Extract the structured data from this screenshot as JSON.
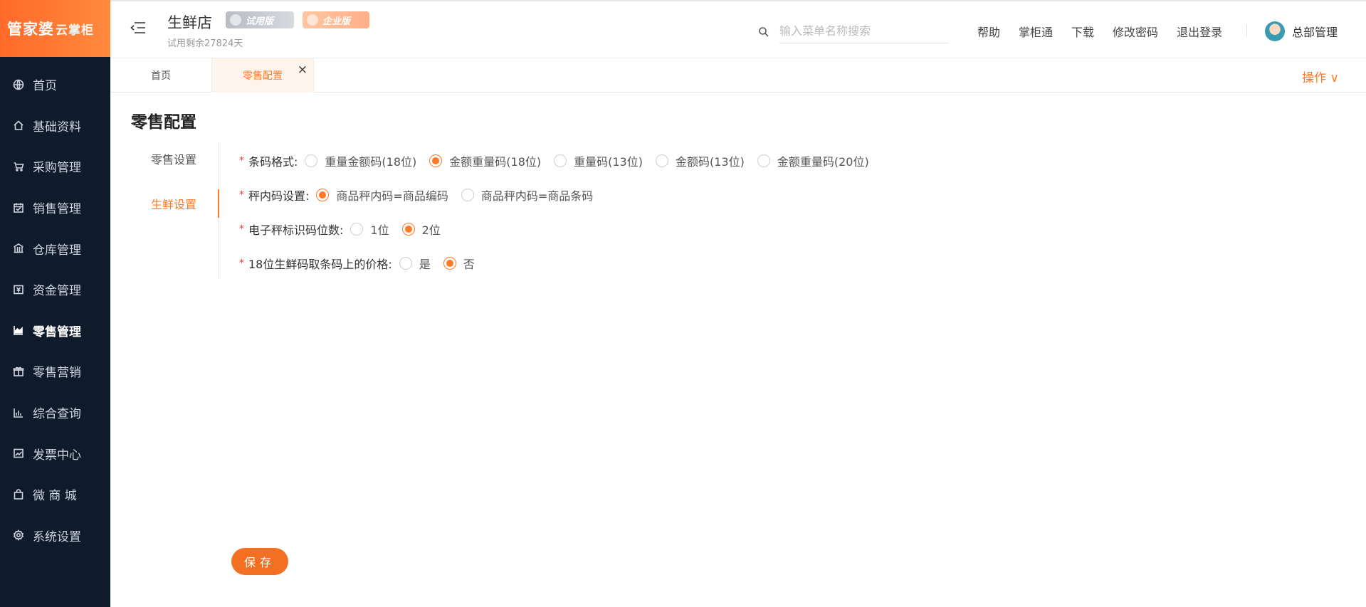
{
  "logo": {
    "main": "管家婆",
    "sub": "云掌柜"
  },
  "sidebar": {
    "items": [
      {
        "label": "首页",
        "icon": "globe-icon"
      },
      {
        "label": "基础资料",
        "icon": "home-icon"
      },
      {
        "label": "采购管理",
        "icon": "cart-icon"
      },
      {
        "label": "销售管理",
        "icon": "calendar-icon"
      },
      {
        "label": "仓库管理",
        "icon": "warehouse-icon"
      },
      {
        "label": "资金管理",
        "icon": "money-icon"
      },
      {
        "label": "零售管理",
        "icon": "area-chart-icon",
        "active": true
      },
      {
        "label": "零售营销",
        "icon": "gift-icon"
      },
      {
        "label": "综合查询",
        "icon": "bar-chart-icon"
      },
      {
        "label": "发票中心",
        "icon": "line-chart-icon"
      },
      {
        "label": "微 商 城",
        "icon": "bag-icon"
      },
      {
        "label": "系统设置",
        "icon": "gear-icon"
      }
    ]
  },
  "header": {
    "store_name": "生鲜店",
    "badge_trial": "试用版",
    "badge_enterprise": "企业版",
    "trial_remaining": "试用剩余27824天",
    "search_placeholder": "输入菜单名称搜索",
    "links": [
      "帮助",
      "掌柜通",
      "下载",
      "修改密码",
      "退出登录"
    ],
    "user_name": "总部管理"
  },
  "tabs": {
    "home": "首页",
    "active": "零售配置",
    "close": "×",
    "ops_label": "操作 ∨"
  },
  "page": {
    "title": "零售配置",
    "subnav": [
      {
        "label": "零售设置",
        "active": false
      },
      {
        "label": "生鲜设置",
        "active": true
      }
    ],
    "form": {
      "rows": [
        {
          "label": "条码格式:",
          "options": [
            "重量金额码(18位)",
            "金额重量码(18位)",
            "重量码(13位)",
            "金额码(13位)",
            "金额重量码(20位)"
          ],
          "selected": 1
        },
        {
          "label": "秤内码设置:",
          "options": [
            "商品秤内码=商品编码",
            "商品秤内码=商品条码"
          ],
          "selected": 0
        },
        {
          "label": "电子秤标识码位数:",
          "options": [
            "1位",
            "2位"
          ],
          "selected": 1
        },
        {
          "label": "18位生鲜码取条码上的价格:",
          "options": [
            "是",
            "否"
          ],
          "selected": 1
        }
      ]
    },
    "save_label": "保存"
  },
  "colors": {
    "accent": "#ff7a26",
    "sidebar_bg": "#0f1a2b",
    "required": "#ff3b30"
  }
}
